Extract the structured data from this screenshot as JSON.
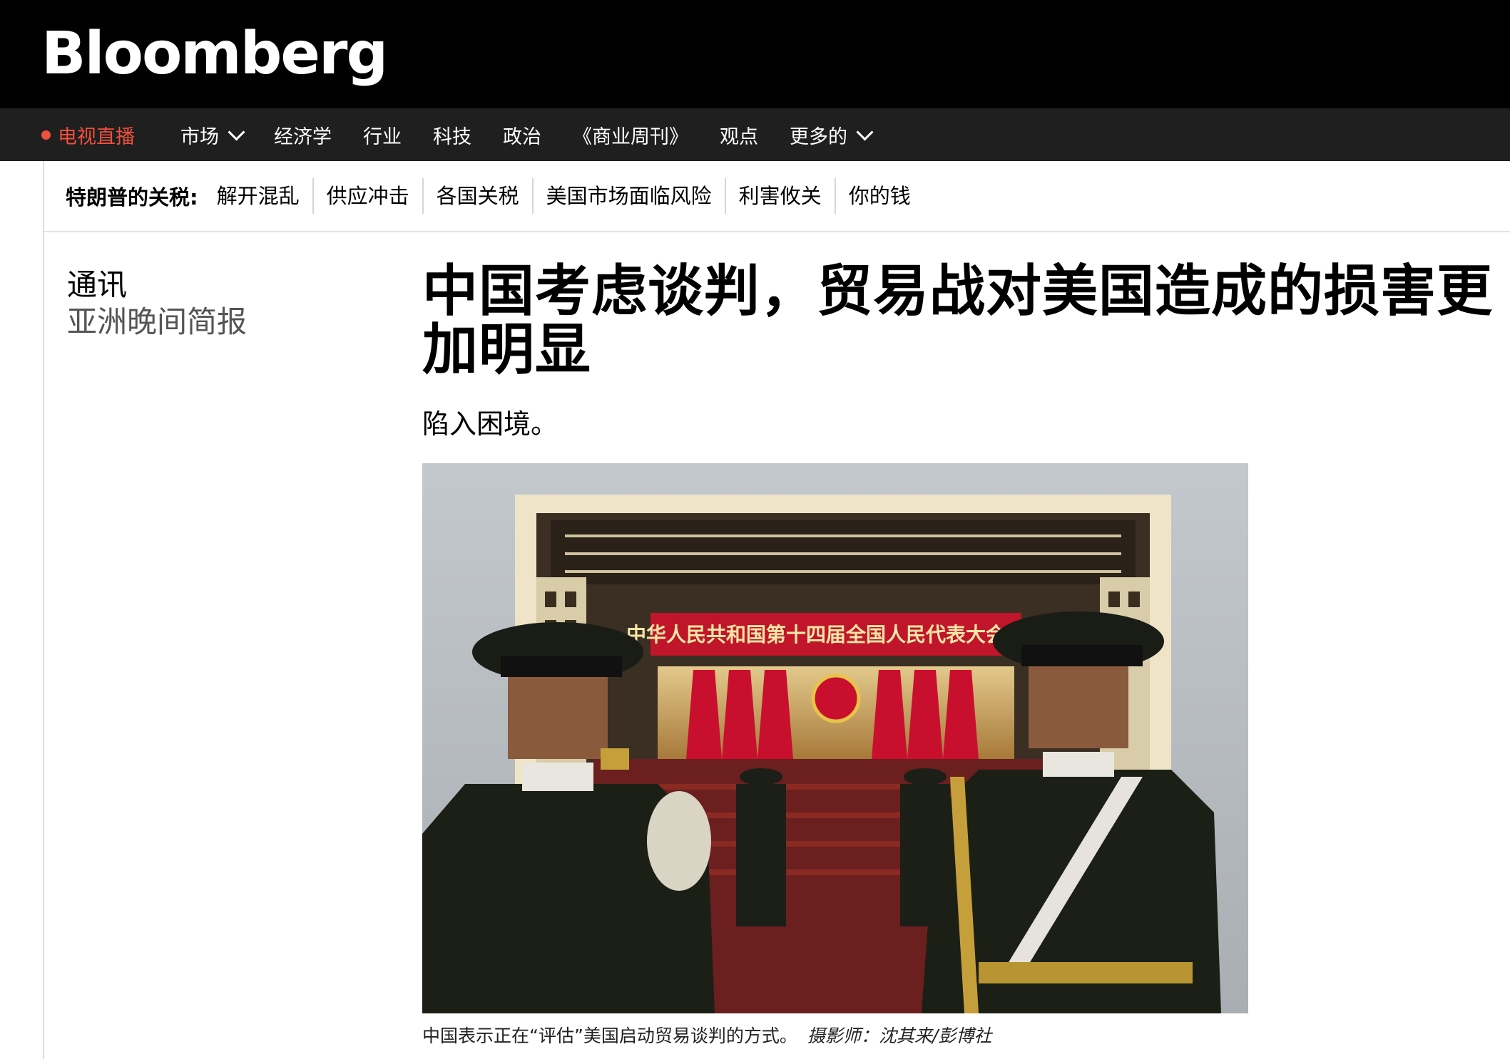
{
  "brand": {
    "logo_text": "Bloomberg"
  },
  "nav": {
    "live_label": "电视直播",
    "items": [
      {
        "label": "市场",
        "dropdown": true
      },
      {
        "label": "经济学",
        "dropdown": false
      },
      {
        "label": "行业",
        "dropdown": false
      },
      {
        "label": "科技",
        "dropdown": false
      },
      {
        "label": "政治",
        "dropdown": false
      },
      {
        "label": "《商业周刊》",
        "dropdown": false
      },
      {
        "label": "观点",
        "dropdown": false
      },
      {
        "label": "更多的",
        "dropdown": true
      }
    ]
  },
  "topic_bar": {
    "heading": "特朗普的关税:",
    "links": [
      "解开混乱",
      "供应冲击",
      "各国关税",
      "美国市场面临风险",
      "利害攸关",
      "你的钱"
    ]
  },
  "article": {
    "section": "通讯",
    "newsletter": "亚洲晚间简报",
    "headline": "中国考虑谈判，贸易战对美国造成的损害更加明显",
    "dek": "陷入困境。",
    "image_banner_text": "中华人民共和国第十四届全国人民代表大会第三",
    "caption": "中国表示正在“评估”美国启动贸易谈判的方式。",
    "credit": "摄影师：沈其来/彭博社"
  },
  "colors": {
    "live_red": "#f0503c",
    "nav_bg": "#1f1f1f",
    "banner_red": "#c0152a"
  }
}
